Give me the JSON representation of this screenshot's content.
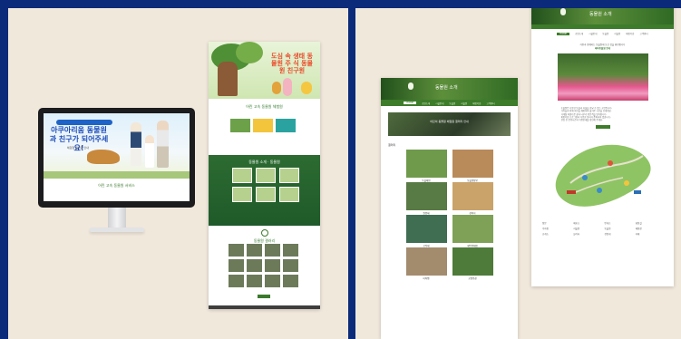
{
  "left": {
    "monitor": {
      "headline": "아쿠아리움 동물원과 친구가 되어주세요!",
      "subtext": "체험형 동물원 안내",
      "service_label": "어린 고속 동물원 서비스"
    },
    "longpage": {
      "hero_title": "도심 속 생태 동물원 주 식 동물원 친구원",
      "section1_title": "어린 고속 동물원 체험원",
      "section2_title": "동물원 소개 · 동물원",
      "gallery_title": "동물원 갤러리"
    }
  },
  "right": {
    "mobile": {
      "logo": "동물원 소개",
      "nav": [
        "HOME",
        "공원소개",
        "시설안내",
        "동물원",
        "식물원",
        "체험학습",
        "고객센터"
      ],
      "feature_caption": "어린이 동물원 체험원 갤러리 안내",
      "gallery_title": "갤러리",
      "tiles": [
        {
          "label": "동물체험",
          "color": "#6f9a4b"
        },
        {
          "label": "동물원탐방",
          "color": "#b98a5a"
        },
        {
          "label": "원앙새",
          "color": "#587a44"
        },
        {
          "label": "강아지",
          "color": "#c9a36a"
        },
        {
          "label": "공작새",
          "color": "#3f6e53"
        },
        {
          "label": "새먹이체험",
          "color": "#7fa157"
        },
        {
          "label": "미어캣",
          "color": "#a38b6d"
        },
        {
          "label": "공원풍경",
          "color": "#4e7a3a"
        }
      ]
    },
    "desktop": {
      "logo": "동물원 소개",
      "menu": [
        "HOME",
        "공원소개",
        "시설안내",
        "동물원",
        "식물원",
        "체험학습",
        "고객센터"
      ],
      "intro_line1": "자연과 함께하는 동물원에 오신 것을 환영합니다",
      "intro_highlight": "테마동물원 안내",
      "body_lines": [
        "동물원은 다양한 동물과 식물을 만날 수 있는 공간입니다.",
        "아이들과 함께 자연을 체험하며 즐거운 시간을 보내세요.",
        "사계절 아름다운 꽃과 나무가 방문객을 맞이합니다.",
        "체험학습 프로그램과 다양한 행사가 준비되어 있습니다.",
        "관람 전 운영시간과 이용안내를 확인해 주세요."
      ],
      "legend": [
        "정문",
        "매표소",
        "안내소",
        "화장실",
        "주차장",
        "식물원",
        "동물원",
        "체험장",
        "휴게소",
        "놀이터",
        "전망대",
        "카페"
      ]
    }
  }
}
